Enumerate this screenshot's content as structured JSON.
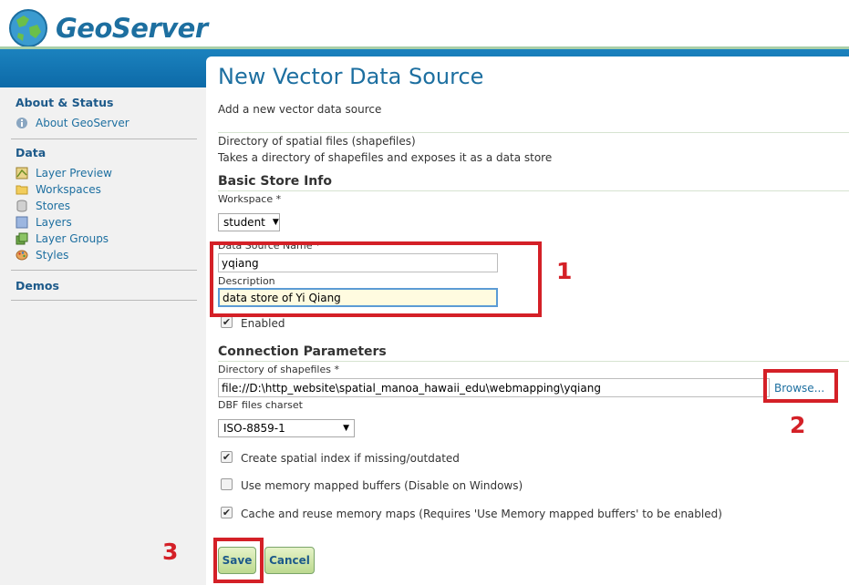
{
  "app": {
    "logo_text": "GeoServer",
    "accent_color": "#1d6fa0"
  },
  "sidebar": {
    "about_section": "About & Status",
    "about_item": "About GeoServer",
    "data_section": "Data",
    "items": [
      {
        "label": "Layer Preview",
        "icon": "layer-preview-icon"
      },
      {
        "label": "Workspaces",
        "icon": "folder-icon"
      },
      {
        "label": "Stores",
        "icon": "database-icon"
      },
      {
        "label": "Layers",
        "icon": "layers-icon"
      },
      {
        "label": "Layer Groups",
        "icon": "layer-groups-icon"
      },
      {
        "label": "Styles",
        "icon": "palette-icon"
      }
    ],
    "demos_section": "Demos"
  },
  "page": {
    "title": "New Vector Data Source",
    "subtitle": "Add a new vector data source",
    "source_type": "Directory of spatial files (shapefiles)",
    "source_desc": "Takes a directory of shapefiles and exposes it as a data store"
  },
  "basic": {
    "heading": "Basic Store Info",
    "workspace_label": "Workspace *",
    "workspace_value": "student",
    "name_label": "Data Source Name *",
    "name_value": "yqiang",
    "description_label": "Description",
    "description_value": "data store of Yi Qiang",
    "enabled_label": "Enabled",
    "enabled_checked": true
  },
  "connection": {
    "heading": "Connection Parameters",
    "dir_label": "Directory of shapefiles *",
    "dir_value": "file://D:\\http_website\\spatial_manoa_hawaii_edu\\webmapping\\yqiang",
    "browse_label": "Browse...",
    "charset_label": "DBF files charset",
    "charset_value": "ISO-8859-1",
    "options": [
      {
        "label": "Create spatial index if missing/outdated",
        "checked": true
      },
      {
        "label": "Use memory mapped buffers (Disable on Windows)",
        "checked": false
      },
      {
        "label": "Cache and reuse memory maps (Requires 'Use Memory mapped buffers' to be enabled)",
        "checked": true
      }
    ]
  },
  "actions": {
    "save_label": "Save",
    "cancel_label": "Cancel"
  },
  "annotations": {
    "one": "1",
    "two": "2",
    "three": "3",
    "color": "#d42027"
  }
}
